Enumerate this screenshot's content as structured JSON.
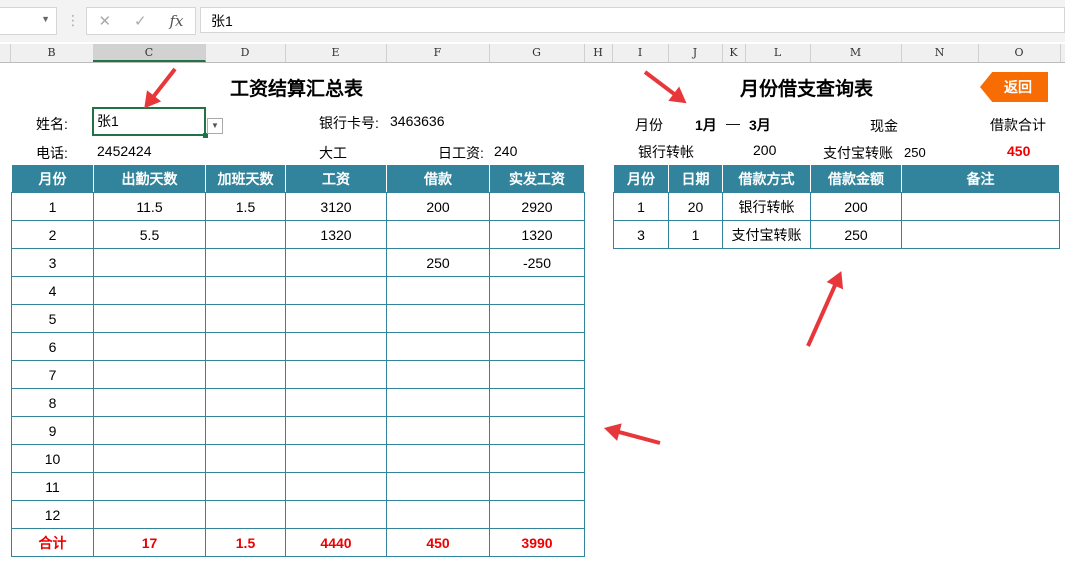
{
  "formula_bar": {
    "cancel_icon": "✕",
    "enter_icon": "✓",
    "fx_label": "fx",
    "value": "张1"
  },
  "columns": [
    "B",
    "C",
    "D",
    "E",
    "F",
    "G",
    "H",
    "I",
    "J",
    "K",
    "L",
    "M",
    "N",
    "O"
  ],
  "summary": {
    "title": "工资结算汇总表",
    "name_label": "姓名:",
    "name_value": "张1",
    "card_label": "银行卡号:",
    "card_value": "3463636",
    "phone_label": "电话:",
    "phone_value": "2452424",
    "type": "大工",
    "daily_label": "日工资:",
    "daily_value": "240",
    "headers": [
      "月份",
      "出勤天数",
      "加班天数",
      "工资",
      "借款",
      "实发工资"
    ],
    "rows": [
      [
        "1",
        "11.5",
        "1.5",
        "3120",
        "200",
        "2920"
      ],
      [
        "2",
        "5.5",
        "",
        "1320",
        "",
        "1320"
      ],
      [
        "3",
        "",
        "",
        "",
        "250",
        "-250"
      ],
      [
        "4",
        "",
        "",
        "",
        "",
        ""
      ],
      [
        "5",
        "",
        "",
        "",
        "",
        ""
      ],
      [
        "6",
        "",
        "",
        "",
        "",
        ""
      ],
      [
        "7",
        "",
        "",
        "",
        "",
        ""
      ],
      [
        "8",
        "",
        "",
        "",
        "",
        ""
      ],
      [
        "9",
        "",
        "",
        "",
        "",
        ""
      ],
      [
        "10",
        "",
        "",
        "",
        "",
        ""
      ],
      [
        "11",
        "",
        "",
        "",
        "",
        ""
      ],
      [
        "12",
        "",
        "",
        "",
        "",
        ""
      ]
    ],
    "total": [
      "合计",
      "17",
      "1.5",
      "4440",
      "450",
      "3990"
    ]
  },
  "query": {
    "title": "月份借支查询表",
    "back_label": "返回",
    "month_label": "月份",
    "month_from": "1月",
    "dash": "—",
    "month_to": "3月",
    "cash_label": "现金",
    "loan_total_label": "借款合计",
    "bank_label": "银行转帐",
    "bank_value": "200",
    "alipay_label": "支付宝转账",
    "alipay_value": "250",
    "loan_total_value": "450",
    "headers": [
      "月份",
      "日期",
      "借款方式",
      "借款金额",
      "备注"
    ],
    "rows": [
      [
        "1",
        "20",
        "银行转帐",
        "200",
        ""
      ],
      [
        "3",
        "1",
        "支付宝转账",
        "250",
        ""
      ]
    ]
  },
  "colors": {
    "header_teal": "#31849b",
    "accent_orange": "#f86c04",
    "total_red": "#e00000",
    "arrow_red": "#e8373a"
  }
}
